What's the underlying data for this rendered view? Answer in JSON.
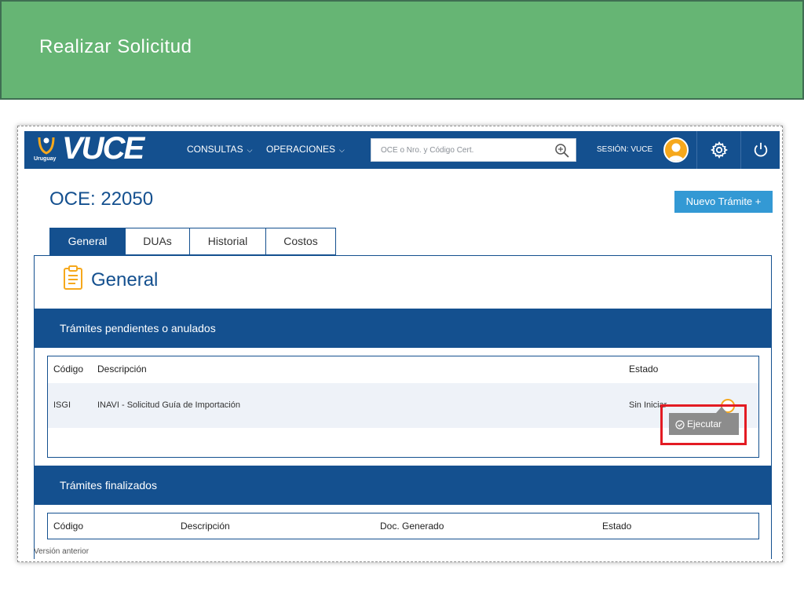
{
  "slide": {
    "title": "Realizar Solicitud"
  },
  "header": {
    "logo_sub": "Uruguay",
    "logo_word": "VUCE",
    "nav": [
      {
        "label": "CONSULTAS"
      },
      {
        "label": "OPERACIONES"
      }
    ],
    "search": {
      "placeholder": "OCE o Nro. y Código Cert.",
      "value": ""
    },
    "session_label": "SESIÓN: VUCE",
    "icons": {
      "search": "search-icon",
      "avatar": "user-avatar",
      "settings": "gear-icon",
      "logout": "power-icon"
    },
    "colors": {
      "navbar": "#14508f",
      "avatar": "#f6a81c"
    }
  },
  "page": {
    "title": "OCE: 22050",
    "new_button": "Nuevo Trámite +",
    "tabs": [
      {
        "label": "General",
        "active": true
      },
      {
        "label": "DUAs",
        "active": false
      },
      {
        "label": "Historial",
        "active": false
      },
      {
        "label": "Costos",
        "active": false
      }
    ]
  },
  "panel": {
    "title": "General",
    "pending": {
      "heading": "Trámites pendientes o anulados",
      "columns": [
        "Código",
        "Descripción",
        "Estado"
      ],
      "rows": [
        {
          "codigo": "ISGI",
          "descripcion": "INAVI - Solicitud Guía de Importación",
          "estado": "Sin Iniciar"
        }
      ],
      "action_label": "Ejecutar"
    },
    "finished": {
      "heading": "Trámites finalizados",
      "columns": [
        "Código",
        "Descripción",
        "Doc. Generado",
        "Estado"
      ]
    },
    "footer_link": "Versión anterior"
  }
}
